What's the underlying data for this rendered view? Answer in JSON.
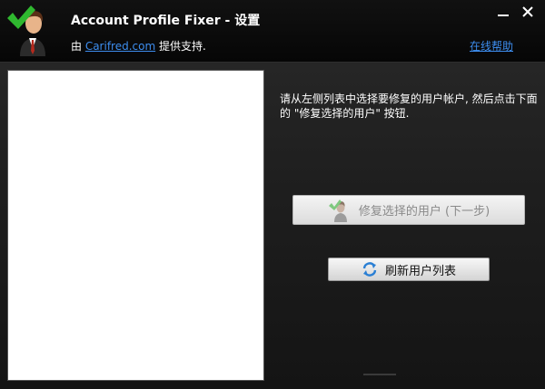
{
  "header": {
    "app_title": "Account Profile Fixer - 设置",
    "support_prefix": "由 ",
    "support_link": "Carifred.com",
    "support_suffix": " 提供支持.",
    "help_link": "在线帮助"
  },
  "window_controls": {
    "minimize_icon": "minimize-icon",
    "close_icon": "close-icon"
  },
  "user_list": {
    "items": []
  },
  "main": {
    "instructions": "请从左侧列表中选择要修复的用户帐户, 然后点击下面的 \"修复选择的用户\" 按钮.",
    "fix_button_label": "修复选择的用户 (下一步)",
    "fix_button_icon": "user-check-icon",
    "fix_button_enabled": false,
    "refresh_button_label": "刷新用户列表",
    "refresh_button_icon": "refresh-icon"
  },
  "colors": {
    "link": "#3d8ef0",
    "check_green": "#2fb82f",
    "background": "#1a1a1a"
  }
}
